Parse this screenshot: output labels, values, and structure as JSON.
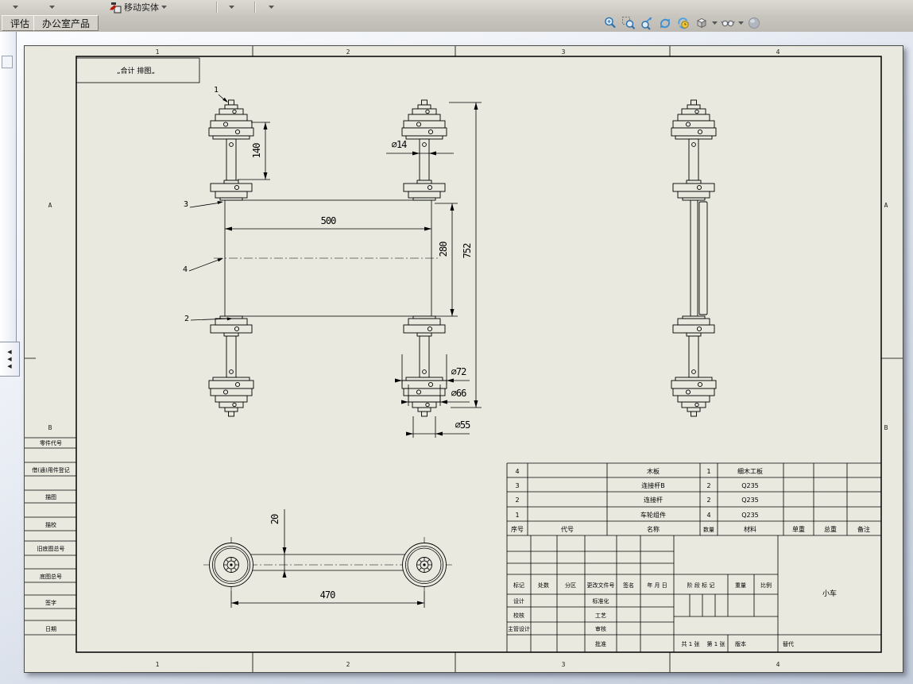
{
  "chrome": {
    "ribbon": {
      "move_entity_label": "移动实体",
      "dropdown_icon": "chevron-down-icon"
    },
    "tabs": [
      {
        "label": "评估"
      },
      {
        "label": "办公室产品"
      }
    ],
    "view_toolbar_icons": [
      "zoom-to-fit-icon",
      "zoom-to-area-icon",
      "zoom-in-out-icon",
      "previous-view-icon",
      "3d-drawing-view-icon",
      "view-orientation-cube-icon",
      "display-style-glasses-icon",
      "appearances-sphere-icon"
    ]
  },
  "sheet": {
    "note": "„合计 排图„",
    "zone_numbers": [
      "1",
      "2",
      "3",
      "4"
    ],
    "zone_letters": [
      "A",
      "B"
    ],
    "dimensions": {
      "height_140": "140",
      "dia_14": "∅14",
      "width_500": "500",
      "height_280": "280",
      "height_752": "752",
      "dia_72": "∅72",
      "dia_66": "∅66",
      "dia_55": "∅55",
      "thickness_20": "20",
      "span_470": "470"
    },
    "balloons": {
      "b1": "1",
      "b2": "2",
      "b3": "3",
      "b4": "4"
    },
    "bom": {
      "headers": [
        "序号",
        "代号",
        "名称",
        "数量",
        "材料",
        "单重",
        "总重",
        "备注"
      ],
      "rows": [
        {
          "no": "4",
          "code": "",
          "name": "木板",
          "qty": "1",
          "material": "细木工板"
        },
        {
          "no": "3",
          "code": "",
          "name": "连接杆B",
          "qty": "2",
          "material": "Q235"
        },
        {
          "no": "2",
          "code": "",
          "name": "连接杆",
          "qty": "2",
          "material": "Q235"
        },
        {
          "no": "1",
          "code": "",
          "name": "车轮组件",
          "qty": "4",
          "material": "Q235"
        }
      ]
    },
    "title_block": {
      "revision_headers": [
        "标记",
        "处数",
        "分区",
        "更改文件号",
        "签名",
        "年 月 日"
      ],
      "left_labels": [
        "设计",
        "校核",
        "主管设计"
      ],
      "mid_labels": [
        "标准化",
        "工艺",
        "审核",
        "批准"
      ],
      "stage_mark": "阶 段 标 记",
      "weight": "重量",
      "scale": "比例",
      "title": "小车",
      "sheets_total": "共 1 张",
      "sheet_no": "第 1 张",
      "version": "版本",
      "substitute": "替代"
    },
    "margin_table": [
      "零件代号",
      "借(通)用件登记",
      "描图",
      "描校",
      "旧底图总号",
      "底图总号",
      "签字",
      "日期"
    ]
  }
}
